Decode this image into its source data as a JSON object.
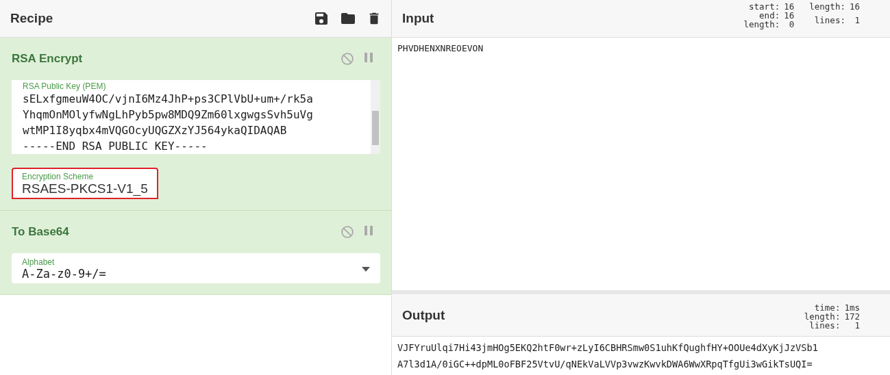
{
  "recipe": {
    "title": "Recipe",
    "operations": [
      {
        "title": "RSA Encrypt",
        "disabled": false,
        "paused": false,
        "fields": [
          {
            "kind": "textarea",
            "label": "RSA Public Key (PEM)",
            "lines": [
              "sELxfgmeuW4OC/vjnI6Mz4JhP+ps3CPlVbU+um+/rk5a",
              "YhqmOnMOlyfwNgLhPyb5pw8MDQ9Zm60lxgwgsSvh5uVg",
              "wtMP1I8yqbx4mVQGOcyUQGZXzYJ564ykaQIDAQAB",
              "-----END RSA PUBLIC KEY-----"
            ]
          },
          {
            "kind": "select",
            "label": "Encryption Scheme",
            "value": "RSAES-PKCS1-V1_5",
            "highlighted": true
          }
        ]
      },
      {
        "title": "To Base64",
        "disabled": false,
        "paused": false,
        "fields": [
          {
            "kind": "dropdown",
            "label": "Alphabet",
            "value": "A-Za-z0-9+/=",
            "highlighted": false
          }
        ]
      }
    ]
  },
  "input": {
    "title": "Input",
    "stats": [
      [
        "start:",
        "16"
      ],
      [
        "end:",
        "16"
      ],
      [
        "length:",
        "0"
      ]
    ],
    "stats2": [
      [
        "length:",
        "16"
      ],
      [
        "lines:",
        "1"
      ]
    ],
    "text": "PHVDHENXNREOEVON"
  },
  "output": {
    "title": "Output",
    "stats": [
      [
        "time:",
        "1ms"
      ],
      [
        "length:",
        "172"
      ],
      [
        "lines:",
        "1"
      ]
    ],
    "lines": [
      "VJFYruUlqi7Hi43jmHOg5EKQ2htF0wr+zLyI6CBHRSmw0S1uhKfQughfHY+OOUe4dXyKjJzVSb1",
      "A7l3d1A/0iGC++dpML0oFBF25VtvU/qNEkVaLVVp3vwzKwvkDWA6WwXRpqTfgUi3wGikTsUQI="
    ]
  }
}
